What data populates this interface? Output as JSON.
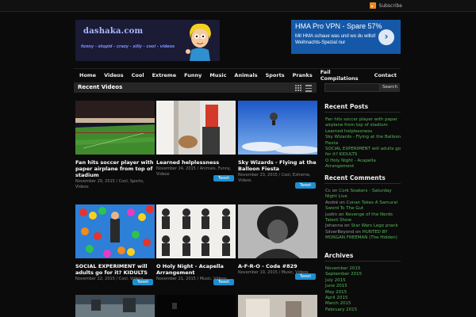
{
  "header": {
    "subscribe_label": "Subscribe",
    "logo_title": "dashaka.com",
    "logo_tagline": "funny - stupid - crazy - silly - cool - videos"
  },
  "ad": {
    "title": "HMA Pro VPN - Spare 57%",
    "text": "Mit HMA schaue was und wo du willst! Weihnachts-Spezial nur",
    "button_icon": "chevron-right-icon"
  },
  "nav": [
    "Home",
    "Videos",
    "Cool",
    "Extreme",
    "Funny",
    "Music",
    "Animals",
    "Sports",
    "Pranks",
    "Fail Compilations",
    "Contact"
  ],
  "recent": {
    "title": "Recent Videos",
    "tweet_label": "Tweet",
    "videos": [
      {
        "title": "Fan hits soccer player with paper airplane from top of stadium",
        "meta": "November 29, 2015 / Cool, Sports, Videos"
      },
      {
        "title": "Learned helplessness",
        "meta": "November 24, 2015 / Animals, Funny, Videos"
      },
      {
        "title": "Sky Wizards - Flying at the Balloon Fiesta",
        "meta": "November 23, 2015 / Cool, Extreme, Videos"
      },
      {
        "title": "SOCIAL EXPERIMENT will adults go for it? KIDULTS",
        "meta": "November 22, 2015 / Cool, Videos"
      },
      {
        "title": "O Holy Night - Acapella Arrangement",
        "meta": "November 21, 2015 / Music, Videos"
      },
      {
        "title": "A-F-R-O - Code #829",
        "meta": "November 19, 2015 / Music, Videos"
      }
    ]
  },
  "sidebar": {
    "search_button": "Search",
    "recent_posts_title": "Recent Posts",
    "recent_posts": [
      "Fan hits soccer player with paper airplane from top of stadium",
      "Learned helplessness",
      "Sky Wizards - Flying at the Balloon Fiesta",
      "SOCIAL EXPERIMENT will adults go for it? KIDULTS",
      "O Holy Night - Acapella Arrangement"
    ],
    "recent_comments_title": "Recent Comments",
    "comments": [
      {
        "author": "Cc",
        "on": "on",
        "post": "Cork Soakers - Saturday Night Live"
      },
      {
        "author": "André",
        "on": "on",
        "post": "Conan Takes A Samurai Sword To The Gut"
      },
      {
        "author": "justin",
        "on": "on",
        "post": "Revenge of the Nerds Talent Show"
      },
      {
        "author": "Johanna",
        "on": "on",
        "post": "Star Wars Lego prank"
      },
      {
        "author": "SilverBeyond",
        "on": "on",
        "post": "HUNTED BY MORGAN FREEMAN (The Hidden)"
      }
    ],
    "archives_title": "Archives",
    "archives": [
      "November 2015",
      "September 2015",
      "July 2015",
      "June 2015",
      "May 2015",
      "April 2015",
      "March 2015",
      "February 2015"
    ]
  }
}
